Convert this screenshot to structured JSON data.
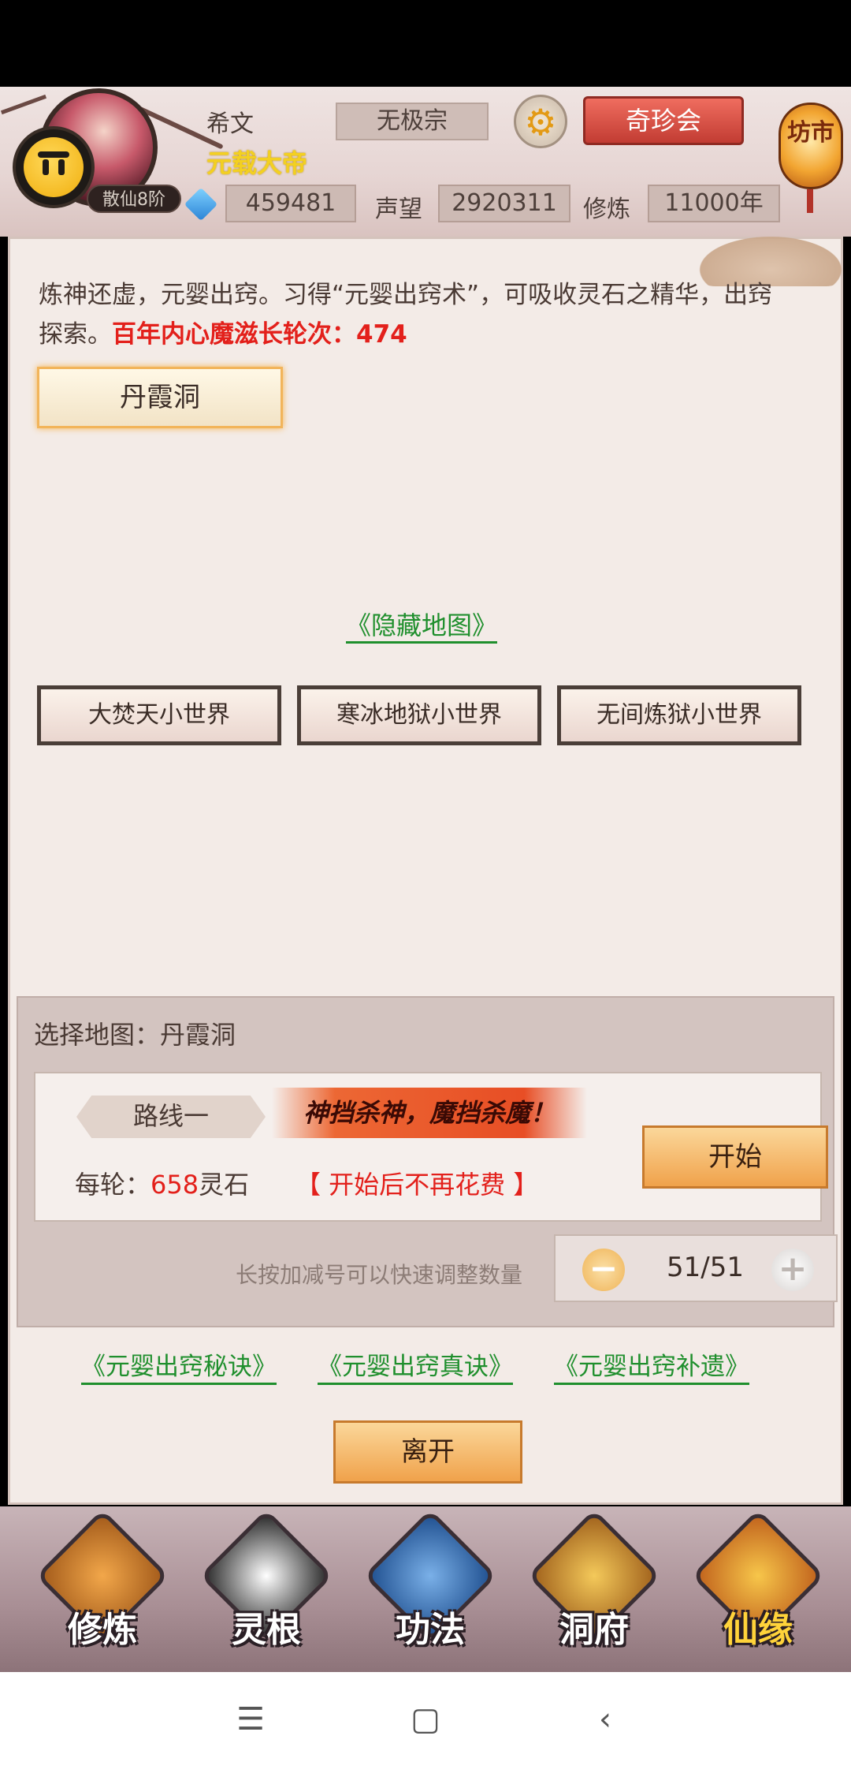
{
  "header": {
    "player_name": "希文",
    "player_title": "元载大帝",
    "sect": "无极宗",
    "rank": "散仙8阶",
    "treasure_button": "奇珍会",
    "market_label": "坊市",
    "spirit_stones": "459481",
    "reputation_label": "声望",
    "reputation_value": "2920311",
    "cultivation_label": "修炼",
    "cultivation_value": "11000年",
    "gear_icon": "gear-icon"
  },
  "main": {
    "desc_text": "炼神还虚，元婴出窍。习得“元婴出窍术”，可吸收灵石之精华，出窍探索。",
    "desc_red": "百年内心魔滋长轮次：474",
    "map_button": "丹霞洞",
    "hidden_map_link": "《隐藏地图》",
    "worlds": [
      "大焚天小世界",
      "寒冰地狱小世界",
      "无间炼狱小世界"
    ]
  },
  "select": {
    "title": "选择地图：丹霞洞",
    "route_name": "路线一",
    "slogan": "神挡杀神，魔挡杀魔！",
    "cost_prefix": "每轮：",
    "cost_value": "658",
    "cost_unit": "灵石",
    "cost_note": "【 开始后不再花费 】",
    "start_button": "开始",
    "hint": "长按加减号可以快速调整数量",
    "count": "51/51"
  },
  "links": [
    "《元婴出窍秘诀》",
    "《元婴出窍真诀》",
    "《元婴出窍补遗》"
  ],
  "leave_button": "离开",
  "nav": [
    "修炼",
    "灵根",
    "功法",
    "洞府",
    "仙缘"
  ],
  "colors": {
    "accent_red": "#e3201b",
    "link_green": "#1f8f2d",
    "button_orange": "#f0a24b"
  }
}
